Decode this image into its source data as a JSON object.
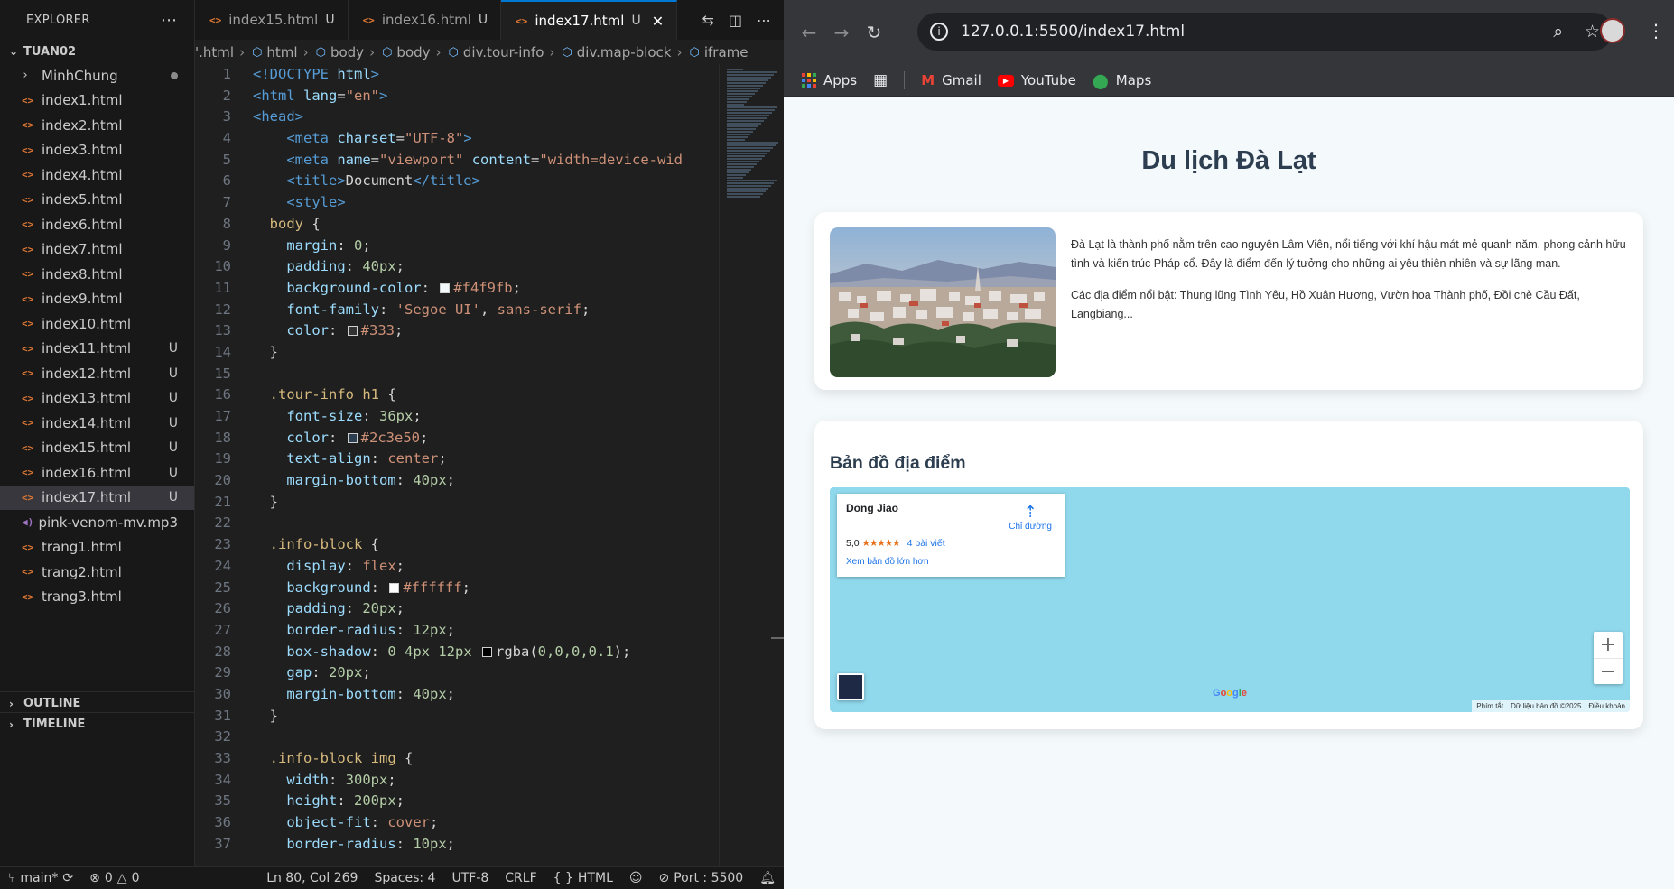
{
  "explorer": {
    "title": "EXPLORER",
    "folder": "TUAN02",
    "items": [
      {
        "name": "MinhChung",
        "kind": "folder",
        "status": "dot"
      },
      {
        "name": "index1.html",
        "kind": "html",
        "status": ""
      },
      {
        "name": "index2.html",
        "kind": "html",
        "status": ""
      },
      {
        "name": "index3.html",
        "kind": "html",
        "status": ""
      },
      {
        "name": "index4.html",
        "kind": "html",
        "status": ""
      },
      {
        "name": "index5.html",
        "kind": "html",
        "status": ""
      },
      {
        "name": "index6.html",
        "kind": "html",
        "status": ""
      },
      {
        "name": "index7.html",
        "kind": "html",
        "status": ""
      },
      {
        "name": "index8.html",
        "kind": "html",
        "status": ""
      },
      {
        "name": "index9.html",
        "kind": "html",
        "status": ""
      },
      {
        "name": "index10.html",
        "kind": "html",
        "status": ""
      },
      {
        "name": "index11.html",
        "kind": "html",
        "status": "U"
      },
      {
        "name": "index12.html",
        "kind": "html",
        "status": "U"
      },
      {
        "name": "index13.html",
        "kind": "html",
        "status": "U"
      },
      {
        "name": "index14.html",
        "kind": "html",
        "status": "U"
      },
      {
        "name": "index15.html",
        "kind": "html",
        "status": "U"
      },
      {
        "name": "index16.html",
        "kind": "html",
        "status": "U"
      },
      {
        "name": "index17.html",
        "kind": "html",
        "status": "U",
        "selected": true
      },
      {
        "name": "pink-venom-mv.mp3",
        "kind": "media",
        "status": ""
      },
      {
        "name": "trang1.html",
        "kind": "html",
        "status": ""
      },
      {
        "name": "trang2.html",
        "kind": "html",
        "status": ""
      },
      {
        "name": "trang3.html",
        "kind": "html",
        "status": ""
      }
    ],
    "outline": "OUTLINE",
    "timeline": "TIMELINE"
  },
  "tabs": [
    {
      "label": "index15.html",
      "status": "U",
      "active": false
    },
    {
      "label": "index16.html",
      "status": "U",
      "active": false
    },
    {
      "label": "index17.html",
      "status": "U",
      "active": true
    }
  ],
  "breadcrumbs": [
    "'.html",
    "html",
    "body",
    "body",
    "div.tour-info",
    "div.map-block",
    "iframe"
  ],
  "code_lines": [
    {
      "n": 1,
      "t": [
        [
          "tag",
          "<!DOCTYPE"
        ],
        [
          "def",
          " "
        ],
        [
          "attr",
          "html"
        ],
        [
          "tag",
          ">"
        ]
      ]
    },
    {
      "n": 2,
      "t": [
        [
          "tag",
          "<html"
        ],
        [
          "def",
          " "
        ],
        [
          "attr",
          "lang"
        ],
        [
          "def",
          "="
        ],
        [
          "str",
          "\"en\""
        ],
        [
          "tag",
          ">"
        ]
      ]
    },
    {
      "n": 3,
      "t": [
        [
          "tag",
          "<head>"
        ]
      ]
    },
    {
      "n": 4,
      "t": [
        [
          "def",
          "    "
        ],
        [
          "tag",
          "<meta"
        ],
        [
          "def",
          " "
        ],
        [
          "attr",
          "charset"
        ],
        [
          "def",
          "="
        ],
        [
          "str",
          "\"UTF-8\""
        ],
        [
          "tag",
          ">"
        ]
      ]
    },
    {
      "n": 5,
      "t": [
        [
          "def",
          "    "
        ],
        [
          "tag",
          "<meta"
        ],
        [
          "def",
          " "
        ],
        [
          "attr",
          "name"
        ],
        [
          "def",
          "="
        ],
        [
          "str",
          "\"viewport\""
        ],
        [
          "def",
          " "
        ],
        [
          "attr",
          "content"
        ],
        [
          "def",
          "="
        ],
        [
          "str",
          "\"width=device-wid"
        ]
      ]
    },
    {
      "n": 6,
      "t": [
        [
          "def",
          "    "
        ],
        [
          "tag",
          "<title>"
        ],
        [
          "def",
          "Document"
        ],
        [
          "tag",
          "</title>"
        ]
      ]
    },
    {
      "n": 7,
      "t": [
        [
          "def",
          "    "
        ],
        [
          "tag",
          "<style>"
        ]
      ]
    },
    {
      "n": 8,
      "t": [
        [
          "def",
          "  "
        ],
        [
          "sel",
          "body"
        ],
        [
          "def",
          " {"
        ]
      ]
    },
    {
      "n": 9,
      "t": [
        [
          "def",
          "    "
        ],
        [
          "prop",
          "margin"
        ],
        [
          "def",
          ": "
        ],
        [
          "num",
          "0"
        ],
        [
          "def",
          ";"
        ]
      ]
    },
    {
      "n": 10,
      "t": [
        [
          "def",
          "    "
        ],
        [
          "prop",
          "padding"
        ],
        [
          "def",
          ": "
        ],
        [
          "num",
          "40px"
        ],
        [
          "def",
          ";"
        ]
      ]
    },
    {
      "n": 11,
      "t": [
        [
          "def",
          "    "
        ],
        [
          "prop",
          "background-color"
        ],
        [
          "def",
          ": "
        ],
        [
          "swatch",
          "#f4f9fb"
        ],
        [
          "val",
          "#f4f9fb"
        ],
        [
          "def",
          ";"
        ]
      ]
    },
    {
      "n": 12,
      "t": [
        [
          "def",
          "    "
        ],
        [
          "prop",
          "font-family"
        ],
        [
          "def",
          ": "
        ],
        [
          "val",
          "'Segoe UI'"
        ],
        [
          "def",
          ", "
        ],
        [
          "val",
          "sans-serif"
        ],
        [
          "def",
          ";"
        ]
      ]
    },
    {
      "n": 13,
      "t": [
        [
          "def",
          "    "
        ],
        [
          "prop",
          "color"
        ],
        [
          "def",
          ": "
        ],
        [
          "swatch",
          "#333333"
        ],
        [
          "val",
          "#333"
        ],
        [
          "def",
          ";"
        ]
      ]
    },
    {
      "n": 14,
      "t": [
        [
          "def",
          "  }"
        ]
      ]
    },
    {
      "n": 15,
      "t": [
        [
          "def",
          ""
        ]
      ]
    },
    {
      "n": 16,
      "t": [
        [
          "def",
          "  "
        ],
        [
          "sel",
          ".tour-info h1"
        ],
        [
          "def",
          " {"
        ]
      ]
    },
    {
      "n": 17,
      "t": [
        [
          "def",
          "    "
        ],
        [
          "prop",
          "font-size"
        ],
        [
          "def",
          ": "
        ],
        [
          "num",
          "36px"
        ],
        [
          "def",
          ";"
        ]
      ]
    },
    {
      "n": 18,
      "t": [
        [
          "def",
          "    "
        ],
        [
          "prop",
          "color"
        ],
        [
          "def",
          ": "
        ],
        [
          "swatch",
          "#2c3e50"
        ],
        [
          "val",
          "#2c3e50"
        ],
        [
          "def",
          ";"
        ]
      ]
    },
    {
      "n": 19,
      "t": [
        [
          "def",
          "    "
        ],
        [
          "prop",
          "text-align"
        ],
        [
          "def",
          ": "
        ],
        [
          "val",
          "center"
        ],
        [
          "def",
          ";"
        ]
      ]
    },
    {
      "n": 20,
      "t": [
        [
          "def",
          "    "
        ],
        [
          "prop",
          "margin-bottom"
        ],
        [
          "def",
          ": "
        ],
        [
          "num",
          "40px"
        ],
        [
          "def",
          ";"
        ]
      ]
    },
    {
      "n": 21,
      "t": [
        [
          "def",
          "  }"
        ]
      ]
    },
    {
      "n": 22,
      "t": [
        [
          "def",
          ""
        ]
      ]
    },
    {
      "n": 23,
      "t": [
        [
          "def",
          "  "
        ],
        [
          "sel",
          ".info-block"
        ],
        [
          "def",
          " {"
        ]
      ]
    },
    {
      "n": 24,
      "t": [
        [
          "def",
          "    "
        ],
        [
          "prop",
          "display"
        ],
        [
          "def",
          ": "
        ],
        [
          "val",
          "flex"
        ],
        [
          "def",
          ";"
        ]
      ]
    },
    {
      "n": 25,
      "t": [
        [
          "def",
          "    "
        ],
        [
          "prop",
          "background"
        ],
        [
          "def",
          ": "
        ],
        [
          "swatch",
          "#ffffff"
        ],
        [
          "val",
          "#ffffff"
        ],
        [
          "def",
          ";"
        ]
      ]
    },
    {
      "n": 26,
      "t": [
        [
          "def",
          "    "
        ],
        [
          "prop",
          "padding"
        ],
        [
          "def",
          ": "
        ],
        [
          "num",
          "20px"
        ],
        [
          "def",
          ";"
        ]
      ]
    },
    {
      "n": 27,
      "t": [
        [
          "def",
          "    "
        ],
        [
          "prop",
          "border-radius"
        ],
        [
          "def",
          ": "
        ],
        [
          "num",
          "12px"
        ],
        [
          "def",
          ";"
        ]
      ]
    },
    {
      "n": 28,
      "t": [
        [
          "def",
          "    "
        ],
        [
          "prop",
          "box-shadow"
        ],
        [
          "def",
          ": "
        ],
        [
          "num",
          "0 4px 12px"
        ],
        [
          "def",
          " "
        ],
        [
          "swatch",
          "#000000"
        ],
        [
          "def",
          "rgba("
        ],
        [
          "num",
          "0,0,0,0.1"
        ],
        [
          "def",
          ");"
        ]
      ]
    },
    {
      "n": 29,
      "t": [
        [
          "def",
          "    "
        ],
        [
          "prop",
          "gap"
        ],
        [
          "def",
          ": "
        ],
        [
          "num",
          "20px"
        ],
        [
          "def",
          ";"
        ]
      ]
    },
    {
      "n": 30,
      "t": [
        [
          "def",
          "    "
        ],
        [
          "prop",
          "margin-bottom"
        ],
        [
          "def",
          ": "
        ],
        [
          "num",
          "40px"
        ],
        [
          "def",
          ";"
        ]
      ]
    },
    {
      "n": 31,
      "t": [
        [
          "def",
          "  }"
        ]
      ]
    },
    {
      "n": 32,
      "t": [
        [
          "def",
          ""
        ]
      ]
    },
    {
      "n": 33,
      "t": [
        [
          "def",
          "  "
        ],
        [
          "sel",
          ".info-block img"
        ],
        [
          "def",
          " {"
        ]
      ]
    },
    {
      "n": 34,
      "t": [
        [
          "def",
          "    "
        ],
        [
          "prop",
          "width"
        ],
        [
          "def",
          ": "
        ],
        [
          "num",
          "300px"
        ],
        [
          "def",
          ";"
        ]
      ]
    },
    {
      "n": 35,
      "t": [
        [
          "def",
          "    "
        ],
        [
          "prop",
          "height"
        ],
        [
          "def",
          ": "
        ],
        [
          "num",
          "200px"
        ],
        [
          "def",
          ";"
        ]
      ]
    },
    {
      "n": 36,
      "t": [
        [
          "def",
          "    "
        ],
        [
          "prop",
          "object-fit"
        ],
        [
          "def",
          ": "
        ],
        [
          "val",
          "cover"
        ],
        [
          "def",
          ";"
        ]
      ]
    },
    {
      "n": 37,
      "t": [
        [
          "def",
          "    "
        ],
        [
          "prop",
          "border-radius"
        ],
        [
          "def",
          ": "
        ],
        [
          "num",
          "10px"
        ],
        [
          "def",
          ";"
        ]
      ]
    }
  ],
  "status": {
    "branch": "main*",
    "errors": "0",
    "warnings": "0",
    "position": "Ln 80, Col 269",
    "spaces": "Spaces: 4",
    "encoding": "UTF-8",
    "eol": "CRLF",
    "language": "HTML",
    "port": "Port : 5500"
  },
  "browser": {
    "url": "127.0.0.1:5500/index17.html",
    "bookmarks": [
      "Apps",
      "Gmail",
      "YouTube",
      "Maps"
    ]
  },
  "page": {
    "title": "Du lịch Đà Lạt",
    "para1": "Đà Lạt là thành phố nằm trên cao nguyên Lâm Viên, nổi tiếng với khí hậu mát mẻ quanh năm, phong cảnh hữu tình và kiến trúc Pháp cổ. Đây là điểm đến lý tưởng cho những ai yêu thiên nhiên và sự lãng mạn.",
    "para2": "Các địa điểm nổi bật: Thung lũng Tình Yêu, Hồ Xuân Hương, Vườn hoa Thành phố, Đồi chè Cầu Đất, Langbiang...",
    "map_title": "Bản đồ địa điểm"
  },
  "map": {
    "place_name": "Dong Jiao",
    "directions": "Chỉ đường",
    "rating": "5,0",
    "stars": "★★★★★",
    "reviews": "4 bài viết",
    "bigger_map": "Xem bản đồ lớn hơn",
    "zoom_in": "+",
    "zoom_out": "−",
    "logo": "Google",
    "footer": [
      "Phím tắt",
      "Dữ liệu bản đồ ©2025",
      "Điều khoản"
    ]
  },
  "colors": {
    "vscode_bg": "#1f1f1f",
    "sidebar_bg": "#181818",
    "accent": "#0078d4",
    "chrome_bar": "#35363a",
    "page_bg": "#f4f9fb",
    "heading": "#2c3e50",
    "map_water": "#90d9ed"
  }
}
